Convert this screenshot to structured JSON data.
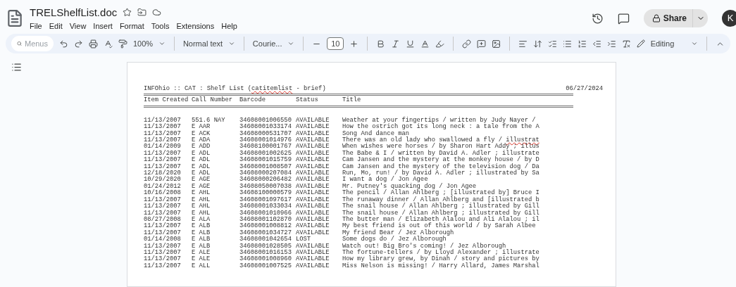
{
  "document": {
    "title": "TRELShelfList.doc"
  },
  "menu": [
    "File",
    "Edit",
    "View",
    "Insert",
    "Format",
    "Tools",
    "Extensions",
    "Help"
  ],
  "share": {
    "label": "Share"
  },
  "avatar": {
    "initial": "K"
  },
  "toolbar": {
    "search_placeholder": "Menus",
    "zoom": "100%",
    "style": "Normal text",
    "font": "Courie...",
    "font_size": "10",
    "mode": "Editing"
  },
  "page": {
    "report_title_before": "INFOhio :: CAT : Shelf List (",
    "report_title_flagged": "catitemlist",
    "report_title_after": " - brief)",
    "date": "06/27/2024",
    "columns": [
      "Item Created",
      "Call Number",
      "Barcode",
      "Status",
      "Title"
    ],
    "rows": [
      {
        "created": "11/13/2007",
        "call_number": "551.6 NAY",
        "barcode": "34608001006550",
        "status": "AVAILABLE",
        "title": "Weather at your fingertips / written by Judy Nayer /",
        "misspelled_last_word": false
      },
      {
        "created": "11/13/2007",
        "call_number": "E AAR",
        "barcode": "34608001033174",
        "status": "AVAILABLE",
        "title": "How the ostrich got its long neck : a tale from the A",
        "misspelled_last_word": false
      },
      {
        "created": "11/13/2007",
        "call_number": "E ACK",
        "barcode": "34608000531707",
        "status": "AVAILABLE",
        "title": "Song And dance man",
        "misspelled_last_word": false
      },
      {
        "created": "11/13/2007",
        "call_number": "E ADA",
        "barcode": "34608001014976",
        "status": "AVAILABLE",
        "title": "There was an old lady who swallowed a fly / illustrat",
        "misspelled_last_word": true
      },
      {
        "created": "01/14/2009",
        "call_number": "E ADD",
        "barcode": "34608100001767",
        "status": "AVAILABLE",
        "title": "When wishes were horses / by Sharon Hart Addy ; illus",
        "misspelled_last_word": false
      },
      {
        "created": "11/13/2007",
        "call_number": "E ADL",
        "barcode": "34608001002625",
        "status": "AVAILABLE",
        "title": "The Babe & I / written by David A. Adler ; illustrate",
        "misspelled_last_word": false
      },
      {
        "created": "11/13/2007",
        "call_number": "E ADL",
        "barcode": "34608001015759",
        "status": "AVAILABLE",
        "title": "Cam Jansen and the mystery at the monkey house / by D",
        "misspelled_last_word": false
      },
      {
        "created": "11/13/2007",
        "call_number": "E ADL",
        "barcode": "34608001008507",
        "status": "AVAILABLE",
        "title": "Cam Jansen and the mystery of the television dog / Da",
        "misspelled_last_word": false
      },
      {
        "created": "12/18/2020",
        "call_number": "E ADL",
        "barcode": "34608000207084",
        "status": "AVAILABLE",
        "title": "Run, Mo, run! / by David A. Adler ; illustrated by Sa",
        "misspelled_last_word": false
      },
      {
        "created": "10/29/2020",
        "call_number": "E AGE",
        "barcode": "34608000206482",
        "status": "AVAILABLE",
        "title": "I want a dog / Jon Agee",
        "misspelled_last_word": false
      },
      {
        "created": "01/24/2012",
        "call_number": "E AGE",
        "barcode": "34608050007038",
        "status": "AVAILABLE",
        "title": "Mr. Putney's quacking dog / Jon Agee",
        "misspelled_last_word": false
      },
      {
        "created": "10/16/2008",
        "call_number": "E AHL",
        "barcode": "34608100000579",
        "status": "AVAILABLE",
        "title": "The pencil / Allan Ahlberg ; [illustrated by] Bruce I",
        "misspelled_last_word": false
      },
      {
        "created": "11/13/2007",
        "call_number": "E AHL",
        "barcode": "34608001097617",
        "status": "AVAILABLE",
        "title": "The runaway dinner / Allan Ahlberg and [illustrated b",
        "misspelled_last_word": false
      },
      {
        "created": "11/13/2007",
        "call_number": "E AHL",
        "barcode": "34608001033034",
        "status": "AVAILABLE",
        "title": "The snail house / Allan Ahlberg ; illustrated by Gill",
        "misspelled_last_word": false
      },
      {
        "created": "11/13/2007",
        "call_number": "E AHL",
        "barcode": "34608001010966",
        "status": "AVAILABLE",
        "title": "The snail house / Allan Ahlberg ; illustrated by Gill",
        "misspelled_last_word": false
      },
      {
        "created": "08/27/2008",
        "call_number": "E ALA",
        "barcode": "34608001102870",
        "status": "AVAILABLE",
        "title": "The butter man / Elizabeth Alalou and Ali Alalou ; il",
        "misspelled_last_word": false
      },
      {
        "created": "11/13/2007",
        "call_number": "E ALB",
        "barcode": "34608001008812",
        "status": "AVAILABLE",
        "title": "My best friend is out of this world / by Sarah Albee",
        "misspelled_last_word": false
      },
      {
        "created": "11/13/2007",
        "call_number": "E ALB",
        "barcode": "34608001034727",
        "status": "AVAILABLE",
        "title": "My friend Bear / Jez Alborough",
        "misspelled_last_word": false
      },
      {
        "created": "01/14/2008",
        "call_number": "E ALB",
        "barcode": "34608001042654",
        "status": "LOST",
        "title": "Some dogs do / Jez Alborough",
        "misspelled_last_word": false
      },
      {
        "created": "11/13/2007",
        "call_number": "E ALB",
        "barcode": "34608001028505",
        "status": "AVAILABLE",
        "title": "Watch out! Big Bro's coming! / Jez Alborough",
        "misspelled_last_word": false
      },
      {
        "created": "11/13/2007",
        "call_number": "E ALE",
        "barcode": "34608001016153",
        "status": "AVAILABLE",
        "title": "The fortune-tellers / by Lloyd Alexander ; illustrate",
        "misspelled_last_word": false
      },
      {
        "created": "11/13/2007",
        "call_number": "E ALE",
        "barcode": "34608001008960",
        "status": "AVAILABLE",
        "title": "How my library grew, by Dinah / story and pictures by",
        "misspelled_last_word": false
      },
      {
        "created": "11/13/2007",
        "call_number": "E ALL",
        "barcode": "34608001007525",
        "status": "AVAILABLE",
        "title": "Miss Nelson is missing! / Harry Allard, James Marshal",
        "misspelled_last_word": false
      }
    ]
  }
}
